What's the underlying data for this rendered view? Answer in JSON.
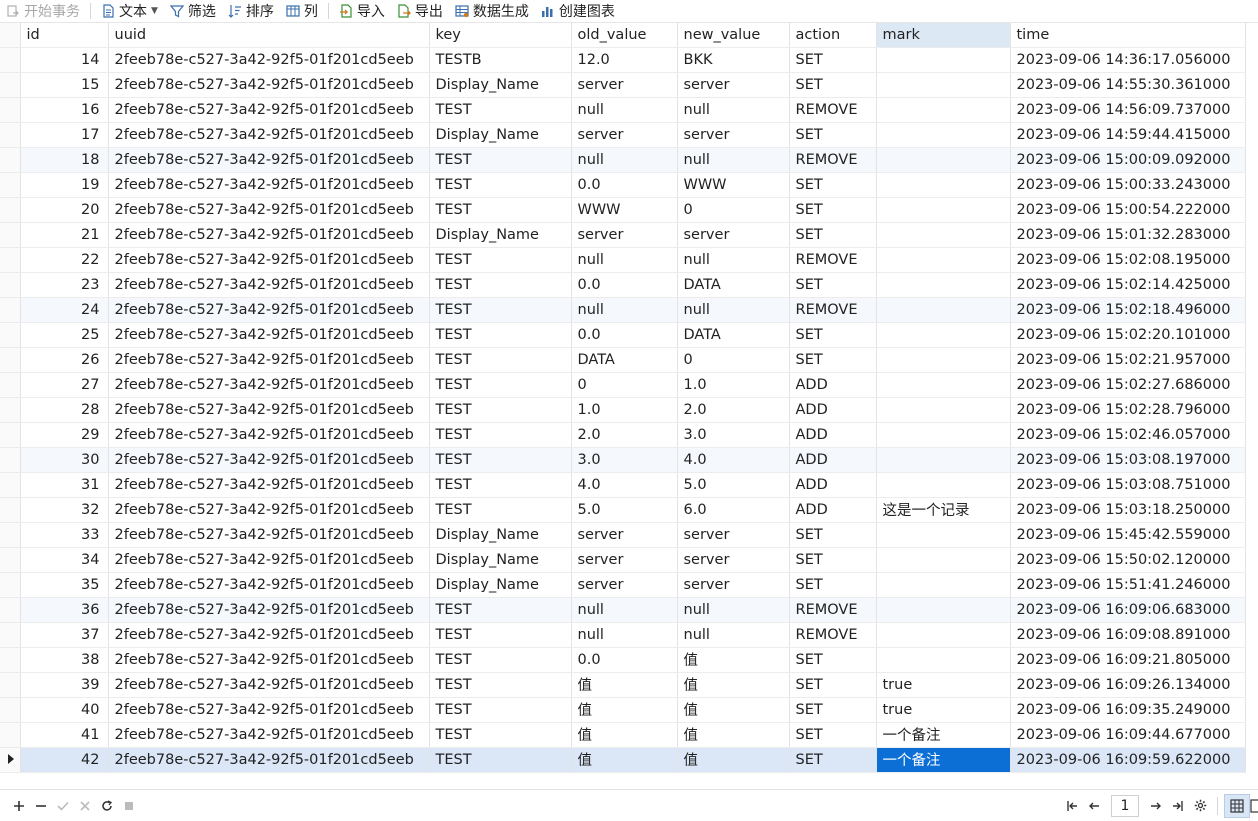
{
  "toolbar": {
    "begin_transaction": "开始事务",
    "text": "文本",
    "filter": "筛选",
    "sort": "排序",
    "columns": "列",
    "import": "导入",
    "export": "导出",
    "data_generation": "数据生成",
    "create_chart": "创建图表"
  },
  "grid": {
    "columns": [
      "id",
      "uuid",
      "key",
      "old_value",
      "new_value",
      "action",
      "mark",
      "time"
    ],
    "rows": [
      [
        "14",
        "2feeb78e-c527-3a42-92f5-01f201cd5eeb",
        "TESTB",
        "12.0",
        "BKK",
        "SET",
        "",
        "2023-09-06 14:36:17.056000"
      ],
      [
        "15",
        "2feeb78e-c527-3a42-92f5-01f201cd5eeb",
        "Display_Name",
        "server",
        "server",
        "SET",
        "",
        "2023-09-06 14:55:30.361000"
      ],
      [
        "16",
        "2feeb78e-c527-3a42-92f5-01f201cd5eeb",
        "TEST",
        "null",
        "null",
        "REMOVE",
        "",
        "2023-09-06 14:56:09.737000"
      ],
      [
        "17",
        "2feeb78e-c527-3a42-92f5-01f201cd5eeb",
        "Display_Name",
        "server",
        "server",
        "SET",
        "",
        "2023-09-06 14:59:44.415000"
      ],
      [
        "18",
        "2feeb78e-c527-3a42-92f5-01f201cd5eeb",
        "TEST",
        "null",
        "null",
        "REMOVE",
        "",
        "2023-09-06 15:00:09.092000"
      ],
      [
        "19",
        "2feeb78e-c527-3a42-92f5-01f201cd5eeb",
        "TEST",
        "0.0",
        "WWW",
        "SET",
        "",
        "2023-09-06 15:00:33.243000"
      ],
      [
        "20",
        "2feeb78e-c527-3a42-92f5-01f201cd5eeb",
        "TEST",
        "WWW",
        "0",
        "SET",
        "",
        "2023-09-06 15:00:54.222000"
      ],
      [
        "21",
        "2feeb78e-c527-3a42-92f5-01f201cd5eeb",
        "Display_Name",
        "server",
        "server",
        "SET",
        "",
        "2023-09-06 15:01:32.283000"
      ],
      [
        "22",
        "2feeb78e-c527-3a42-92f5-01f201cd5eeb",
        "TEST",
        "null",
        "null",
        "REMOVE",
        "",
        "2023-09-06 15:02:08.195000"
      ],
      [
        "23",
        "2feeb78e-c527-3a42-92f5-01f201cd5eeb",
        "TEST",
        "0.0",
        "DATA",
        "SET",
        "",
        "2023-09-06 15:02:14.425000"
      ],
      [
        "24",
        "2feeb78e-c527-3a42-92f5-01f201cd5eeb",
        "TEST",
        "null",
        "null",
        "REMOVE",
        "",
        "2023-09-06 15:02:18.496000"
      ],
      [
        "25",
        "2feeb78e-c527-3a42-92f5-01f201cd5eeb",
        "TEST",
        "0.0",
        "DATA",
        "SET",
        "",
        "2023-09-06 15:02:20.101000"
      ],
      [
        "26",
        "2feeb78e-c527-3a42-92f5-01f201cd5eeb",
        "TEST",
        "DATA",
        "0",
        "SET",
        "",
        "2023-09-06 15:02:21.957000"
      ],
      [
        "27",
        "2feeb78e-c527-3a42-92f5-01f201cd5eeb",
        "TEST",
        "0",
        "1.0",
        "ADD",
        "",
        "2023-09-06 15:02:27.686000"
      ],
      [
        "28",
        "2feeb78e-c527-3a42-92f5-01f201cd5eeb",
        "TEST",
        "1.0",
        "2.0",
        "ADD",
        "",
        "2023-09-06 15:02:28.796000"
      ],
      [
        "29",
        "2feeb78e-c527-3a42-92f5-01f201cd5eeb",
        "TEST",
        "2.0",
        "3.0",
        "ADD",
        "",
        "2023-09-06 15:02:46.057000"
      ],
      [
        "30",
        "2feeb78e-c527-3a42-92f5-01f201cd5eeb",
        "TEST",
        "3.0",
        "4.0",
        "ADD",
        "",
        "2023-09-06 15:03:08.197000"
      ],
      [
        "31",
        "2feeb78e-c527-3a42-92f5-01f201cd5eeb",
        "TEST",
        "4.0",
        "5.0",
        "ADD",
        "",
        "2023-09-06 15:03:08.751000"
      ],
      [
        "32",
        "2feeb78e-c527-3a42-92f5-01f201cd5eeb",
        "TEST",
        "5.0",
        "6.0",
        "ADD",
        "这是一个记录",
        "2023-09-06 15:03:18.250000"
      ],
      [
        "33",
        "2feeb78e-c527-3a42-92f5-01f201cd5eeb",
        "Display_Name",
        "server",
        "server",
        "SET",
        "",
        "2023-09-06 15:45:42.559000"
      ],
      [
        "34",
        "2feeb78e-c527-3a42-92f5-01f201cd5eeb",
        "Display_Name",
        "server",
        "server",
        "SET",
        "",
        "2023-09-06 15:50:02.120000"
      ],
      [
        "35",
        "2feeb78e-c527-3a42-92f5-01f201cd5eeb",
        "Display_Name",
        "server",
        "server",
        "SET",
        "",
        "2023-09-06 15:51:41.246000"
      ],
      [
        "36",
        "2feeb78e-c527-3a42-92f5-01f201cd5eeb",
        "TEST",
        "null",
        "null",
        "REMOVE",
        "",
        "2023-09-06 16:09:06.683000"
      ],
      [
        "37",
        "2feeb78e-c527-3a42-92f5-01f201cd5eeb",
        "TEST",
        "null",
        "null",
        "REMOVE",
        "",
        "2023-09-06 16:09:08.891000"
      ],
      [
        "38",
        "2feeb78e-c527-3a42-92f5-01f201cd5eeb",
        "TEST",
        "0.0",
        "值",
        "SET",
        "",
        "2023-09-06 16:09:21.805000"
      ],
      [
        "39",
        "2feeb78e-c527-3a42-92f5-01f201cd5eeb",
        "TEST",
        "值",
        "值",
        "SET",
        "true",
        "2023-09-06 16:09:26.134000"
      ],
      [
        "40",
        "2feeb78e-c527-3a42-92f5-01f201cd5eeb",
        "TEST",
        "值",
        "值",
        "SET",
        "true",
        "2023-09-06 16:09:35.249000"
      ],
      [
        "41",
        "2feeb78e-c527-3a42-92f5-01f201cd5eeb",
        "TEST",
        "值",
        "值",
        "SET",
        "一个备注",
        "2023-09-06 16:09:44.677000"
      ],
      [
        "42",
        "2feeb78e-c527-3a42-92f5-01f201cd5eeb",
        "TEST",
        "值",
        "值",
        "SET",
        "一个备注",
        "2023-09-06 16:09:59.622000"
      ]
    ],
    "alt_rows": [
      "18",
      "24",
      "30",
      "36"
    ],
    "current_row": "42",
    "selected_column": "mark"
  },
  "bottom_bar": {
    "add_icon": "plus-icon",
    "delete_icon": "minus-icon",
    "apply_icon": "check-icon",
    "discard_icon": "cross-icon",
    "refresh_icon": "refresh-icon",
    "stop_icon": "stop-icon",
    "current_page": "1"
  },
  "colors": {
    "accent": "#0b6fd6",
    "selected_row": "#dbe7f7",
    "header_highlight": "#dde8f5",
    "alt_row": "#f5f8fc"
  }
}
